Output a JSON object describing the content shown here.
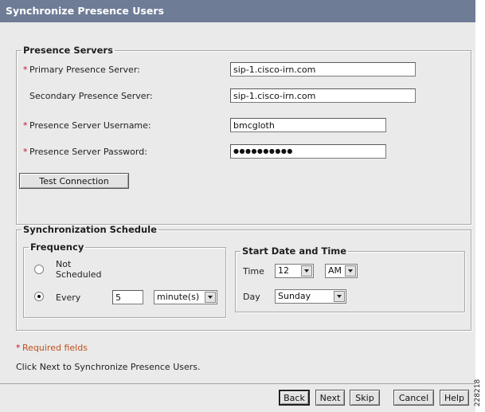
{
  "window": {
    "title": "Synchronize Presence Users"
  },
  "presence_servers": {
    "legend": "Presence Servers",
    "required_marker": "*",
    "primary_label": "Primary Presence Server:",
    "primary_value": "sip-1.cisco-irn.com",
    "secondary_label": "Secondary Presence Server:",
    "secondary_value": "sip-1.cisco-irn.com",
    "username_label": "Presence Server Username:",
    "username_value": "bmcgloth",
    "password_label": "Presence Server Password:",
    "password_value": "●●●●●●●●●●",
    "test_button": "Test Connection"
  },
  "schedule": {
    "legend": "Synchronization Schedule",
    "frequency": {
      "legend": "Frequency",
      "option_not_scheduled_line1": "Not",
      "option_not_scheduled_line2": "Scheduled",
      "not_scheduled_selected": false,
      "option_every": "Every",
      "every_selected": true,
      "every_value": "5",
      "unit_selected": "minute(s)"
    },
    "start": {
      "legend": "Start Date and Time",
      "time_label": "Time",
      "hour_selected": "12",
      "ampm_selected": "AM",
      "day_label": "Day",
      "day_selected": "Sunday"
    }
  },
  "notes": {
    "required_marker": "*",
    "required_fields": "Required fields",
    "instruction": "Click Next to Synchronize Presence Users."
  },
  "footer": {
    "back": "Back",
    "next": "Next",
    "skip": "Skip",
    "cancel": "Cancel",
    "help": "Help"
  },
  "figure_id": "228218"
}
